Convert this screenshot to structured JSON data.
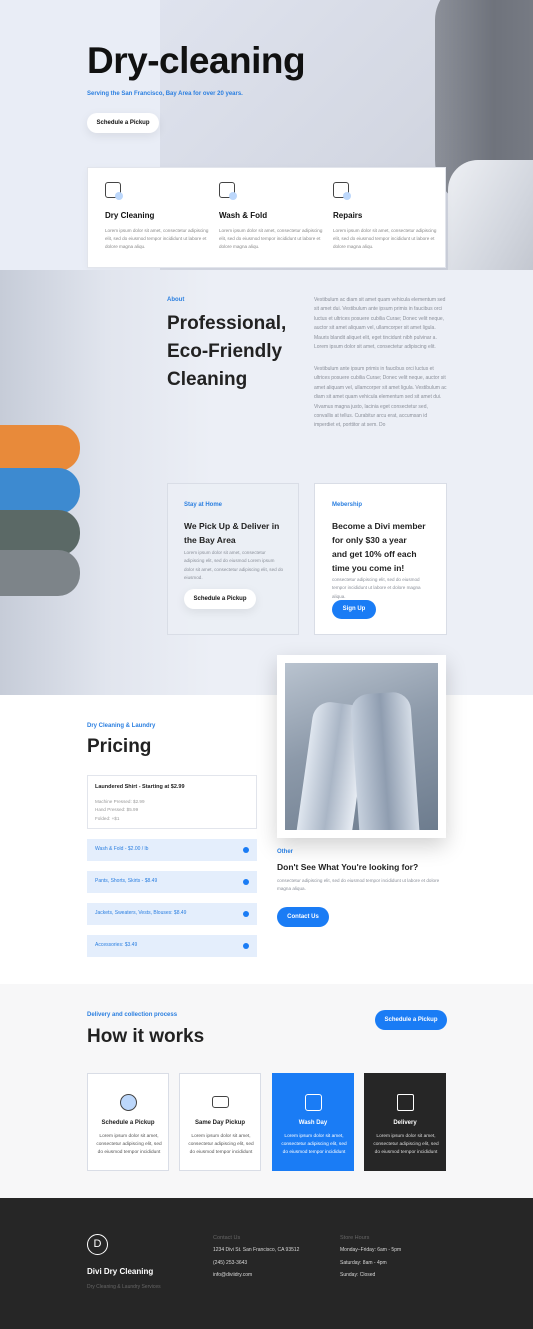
{
  "hero": {
    "title": "Dry-cleaning",
    "subtitle": "Serving the San Francisco, Bay Area for over 20 years.",
    "cta": "Schedule a Pickup"
  },
  "services": [
    {
      "icon": "shirt-icon",
      "title": "Dry Cleaning",
      "text": "Lorem ipsum dolor sit amet, consectetur adipiscing elit, sed do eiusmod tempor incididunt ut labore et dolore magna aliqu."
    },
    {
      "icon": "pants-icon",
      "title": "Wash & Fold",
      "text": "Lorem ipsum dolor sit amet, consectetur adipiscing elit, sed do eiusmod tempor incididunt ut labore et dolore magna aliqu."
    },
    {
      "icon": "heart-hand-icon",
      "title": "Repairs",
      "text": "Lorem ipsum dolor sit amet, consectetur adipiscing elit, sed do eiusmod tempor incididunt ut labore et dolore magna aliqu."
    }
  ],
  "about": {
    "label": "About",
    "heading_line1": "Professional,",
    "heading_line2": "Eco-Friendly",
    "heading_line3": "Cleaning",
    "para1": "Vestibulum ac diam sit amet quam vehicula elementum sed sit amet dui. Vestibulum ante ipsum primis in faucibus orci luctus et ultrices posuere cubilia Curae; Donec velit neque, auctor sit amet aliquam vel, ullamcorper sit amet ligula. Mauris blandit aliquet elit, eget tincidunt nibh pulvinar a. Lorem ipsum dolor sit amet, consectetur adipiscing elit.",
    "para2": "Vestibulum ante ipsum primis in faucibus orci luctus et ultrices posuere cubilia Curae; Donec velit neque, auctor sit amet aliquam vel, ullamcorper sit amet ligula. Vestibulum ac diam sit amet quam vehicula elementum sed sit amet dui. Vivamus magna justo, lacinia eget consectetur sed, convallis at tellus. Curabitur arcu erat, accumsan id imperdiet et, porttitor at sem. Do"
  },
  "card_home": {
    "label": "Stay at Home",
    "title_line1": "We Pick Up & Deliver in",
    "title_line2": "the Bay Area",
    "text": "Lorem ipsum dolor sit amet, consectetur adipiscing elit, sed do eiusmod Lorem ipsum dolor sit amet, consectetur adipiscing elit, sed do eiusmod.",
    "cta": "Schedule a Pickup"
  },
  "card_member": {
    "label": "Mebership",
    "title_line1": "Become a Divi member",
    "title_line2": "for only $30 a year",
    "title_line3": "and get 10% off each",
    "title_line4": "time you come in!",
    "text": "consectetur adipiscing elit, sed do eiusmod tempor incididunt ut labore et dolore magna aliqua.",
    "cta": "Sign Up"
  },
  "pricing": {
    "label": "Dry Cleaning & Laundry",
    "title": "Pricing",
    "box_title": "Laundered Shirt - Starting at $2.99",
    "box_lines": [
      "Machine Pressed: $2.99",
      "Hand Pressed: $5.99",
      "Folded: +$1"
    ],
    "accordion": [
      "Wash & Fold - $2.00 / lb",
      "Pants, Shorts, Skirts - $8.49",
      "Jackets, Sweaters, Vests, Blouses: $8.49",
      "Accessories: $3.49"
    ]
  },
  "other": {
    "label": "Other",
    "title": "Don't See What You're looking for?",
    "text": "consectetur adipiscing elit, sed do eiusmod tempor incididunt ut labore et dolore magna aliqua.",
    "cta": "Contact Us"
  },
  "how": {
    "label": "Delivery and collection process",
    "title": "How it works",
    "cta": "Schedule a Pickup",
    "steps": [
      {
        "icon": "clock-icon",
        "title": "Schedule a Pickup",
        "text": "Lorem ipsum dolor sit amet, consectetur adipiscing elit, sed do eiusmod tempor incididunt"
      },
      {
        "icon": "truck-icon",
        "title": "Same Day Pickup",
        "text": "Lorem ipsum dolor sit amet, consectetur adipiscing elit, sed do eiusmod tempor incididunt"
      },
      {
        "icon": "washing-machine-icon",
        "title": "Wash Day",
        "text": "Lorem ipsum dolor sit amet, consectetur adipiscing elit, sed do eiusmod tempor incididunt"
      },
      {
        "icon": "house-icon",
        "title": "Delivery",
        "text": "Lorem ipsum dolor sit amet, consectetur adipiscing elit, sed do eiusmod tempor incididunt"
      }
    ]
  },
  "footer": {
    "logo_letter": "D",
    "brand": "Divi Dry Cleaning",
    "tagline": "Dry Cleaning & Laundry Services",
    "contact_head": "Contact Us",
    "address": "1234 Divi St. San Francisco, CA 93512",
    "phone": "(245) 253-3643",
    "email": "info@diviidry.com",
    "hours_head": "Store Hours",
    "hours": [
      "Monday–Friday: 6am - 5pm",
      "Saturday: 8am - 4pm",
      "Sunday: Closed"
    ]
  },
  "colors": {
    "accent": "#1a7cf5",
    "dark": "#262626",
    "light_blue": "#e4eefc"
  }
}
